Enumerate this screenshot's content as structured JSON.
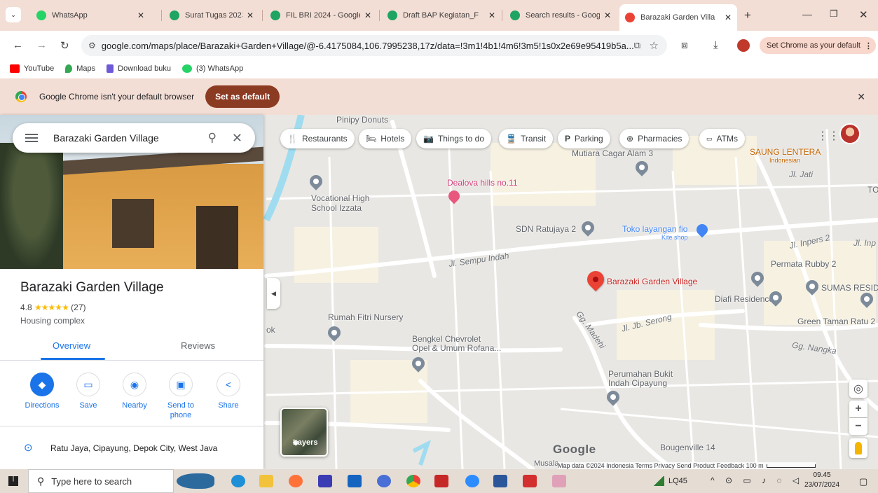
{
  "browser": {
    "tabs": [
      {
        "title": "WhatsApp",
        "color": "#25d366"
      },
      {
        "title": "Surat Tugas 2023 202",
        "color": "#1fa463"
      },
      {
        "title": "FIL BRI 2024 - Google",
        "color": "#1fa463"
      },
      {
        "title": "Draft BAP Kegiatan_F",
        "color": "#1fa463"
      },
      {
        "title": "Search results - Goog",
        "color": "#1fa463"
      },
      {
        "title": "Barazaki Garden Villa",
        "color": "#ea4335"
      }
    ],
    "url": "google.com/maps/place/Barazaki+Garden+Village/@-6.4175084,106.7995238,17z/data=!3m1!4b1!4m6!3m5!1s0x2e69e95419b5a...",
    "set_default_pill": "Set Chrome as your default",
    "bookmarks": [
      {
        "label": "YouTube",
        "color": "#ff0000"
      },
      {
        "label": "Maps",
        "color": "#34a853"
      },
      {
        "label": "Download buku",
        "color": "#6e5ad6"
      },
      {
        "label": "(3) WhatsApp",
        "color": "#25d366"
      }
    ],
    "infobar": {
      "message": "Google Chrome isn't your default browser",
      "button": "Set as default"
    }
  },
  "panel": {
    "search_query": "Barazaki Garden Village",
    "title": "Barazaki Garden Village",
    "rating_value": "4.8",
    "stars": "★★★★★",
    "review_count": "(27)",
    "category": "Housing complex",
    "tabs": [
      "Overview",
      "Reviews"
    ],
    "actions": [
      "Directions",
      "Save",
      "Nearby",
      "Send to\nphone",
      "Share"
    ],
    "address": "Ratu Jaya, Cipayung, Depok City, West Java"
  },
  "map": {
    "chips": [
      {
        "label": "Restaurants",
        "icon": "🍴"
      },
      {
        "label": "Hotels",
        "icon": "🛏"
      },
      {
        "label": "Things to do",
        "icon": "📷"
      },
      {
        "label": "Transit",
        "icon": "🚆"
      },
      {
        "label": "Parking",
        "icon": "P"
      },
      {
        "label": "Pharmacies",
        "icon": "⊕"
      },
      {
        "label": "ATMs",
        "icon": "▭"
      }
    ],
    "place_labels": {
      "pinipy": "Pinipy Donuts",
      "mutiara": "Mutiara Cagar Alam 3",
      "saung": "SAUNG LENTERA",
      "saung_sub": "Indonesian",
      "vocational": "Vocational High\nSchool Izzata",
      "dealova": "Dealova hills no.11",
      "sdn": "SDN Ratujaya 2",
      "toko": "Toko layangan fio",
      "toko_sub": "Kite shop",
      "permata": "Permata Rubby 2",
      "sumas": "SUMAS RESID",
      "diafi": "Diafi Residence",
      "rumah": "Rumah Fitri Nursery",
      "bengkel": "Bengkel Chevrolet\nOpel & Umum Rofana...",
      "perumahan": "Perumahan Bukit\nIndah Cipayung",
      "green": "Green Taman Ratu 2",
      "bougenville": "Bougenville 14",
      "musala": "Musala",
      "to": "TO",
      "ok": "ok"
    },
    "road_labels": {
      "sempu": "Jl. Sempu Indah",
      "serong": "Jl. Jb. Serong",
      "gg_madehi": "Gg. Madehi",
      "gg_nangka": "Gg. Nangka",
      "jl_jati": "Jl. Jati",
      "jl_inpers": "Jl. Inpers 2",
      "jl_inp": "Jl. Inp"
    },
    "selected_place": "Barazaki Garden Village",
    "layers_label": "Layers",
    "google_logo": "Google",
    "attribution": "Map data ©2024    Indonesia    Terms    Privacy    Send Product Feedback    100 m"
  },
  "taskbar": {
    "search_placeholder": "Type here to search",
    "network_label": "LQ45",
    "time": "09.45",
    "date": "23/07/2024"
  }
}
